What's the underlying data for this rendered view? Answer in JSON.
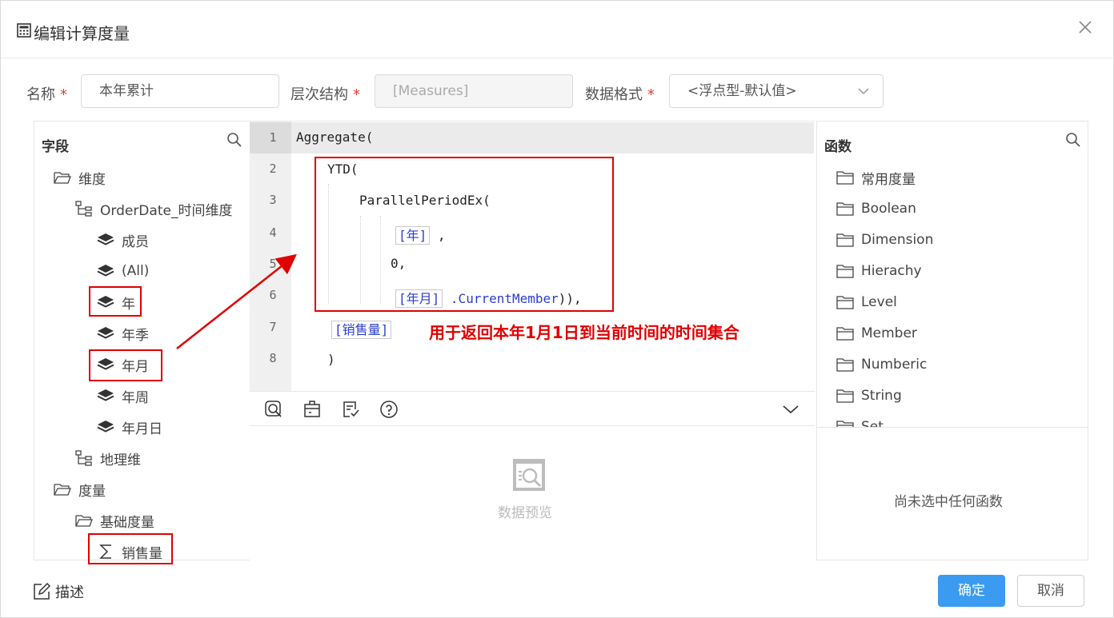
{
  "dialog": {
    "title": "编辑计算度量",
    "close_icon": "close-icon"
  },
  "form": {
    "name_label": "名称",
    "name_value": "本年累计",
    "hierarchy_label": "层次结构",
    "hierarchy_value": "[Measures]",
    "format_label": "数据格式",
    "format_value": "<浮点型-默认值>",
    "required_mark": "*"
  },
  "fields_panel": {
    "title": "字段",
    "tree": [
      {
        "label": "维度",
        "icon": "folder-icon"
      },
      {
        "label": "OrderDate_时间维度",
        "icon": "hierarchy-icon"
      },
      {
        "label": "成员",
        "icon": "layers-icon"
      },
      {
        "label": "(All)",
        "icon": "layers-icon"
      },
      {
        "label": "年",
        "icon": "layers-icon",
        "highlighted": true
      },
      {
        "label": "年季",
        "icon": "layers-icon"
      },
      {
        "label": "年月",
        "icon": "layers-icon",
        "highlighted": true
      },
      {
        "label": "年周",
        "icon": "layers-icon"
      },
      {
        "label": "年月日",
        "icon": "layers-icon"
      },
      {
        "label": "地理维",
        "icon": "hierarchy-icon"
      },
      {
        "label": "度量",
        "icon": "folder-icon"
      },
      {
        "label": "基础度量",
        "icon": "folder-icon"
      },
      {
        "label": "销售量",
        "icon": "sigma-icon",
        "highlighted": true
      }
    ]
  },
  "editor": {
    "line_numbers": [
      "1",
      "2",
      "3",
      "4",
      "5",
      "6",
      "7",
      "8"
    ],
    "tokens": {
      "aggregate": "Aggregate(",
      "ytd": "YTD(",
      "parallel": "ParallelPeriodEx(",
      "year_ref": "[年]",
      "comma": ",",
      "zero": "0,",
      "yearmonth_ref": "[年月]",
      "current_member": ".CurrentMember",
      "close_parens": ")),",
      "sales_ref": "[销售量]",
      "close": ")"
    },
    "annotation": "用于返回本年1月1日到当前时间的时间集合",
    "highlight_color": "#e00000"
  },
  "toolbar": {
    "icons": [
      "search-doc-icon",
      "calendar-icon",
      "check-doc-icon",
      "help-icon",
      "chevron-down-icon"
    ]
  },
  "preview": {
    "label": "数据预览"
  },
  "functions_panel": {
    "title": "函数",
    "items": [
      "常用度量",
      "Boolean",
      "Dimension",
      "Hierachy",
      "Level",
      "Member",
      "Numberic",
      "String",
      "Set"
    ],
    "empty_text": "尚未选中任何函数"
  },
  "footer": {
    "describe_label": "描述",
    "ok_label": "确定",
    "cancel_label": "取消",
    "primary_color": "#3a9bf0"
  }
}
